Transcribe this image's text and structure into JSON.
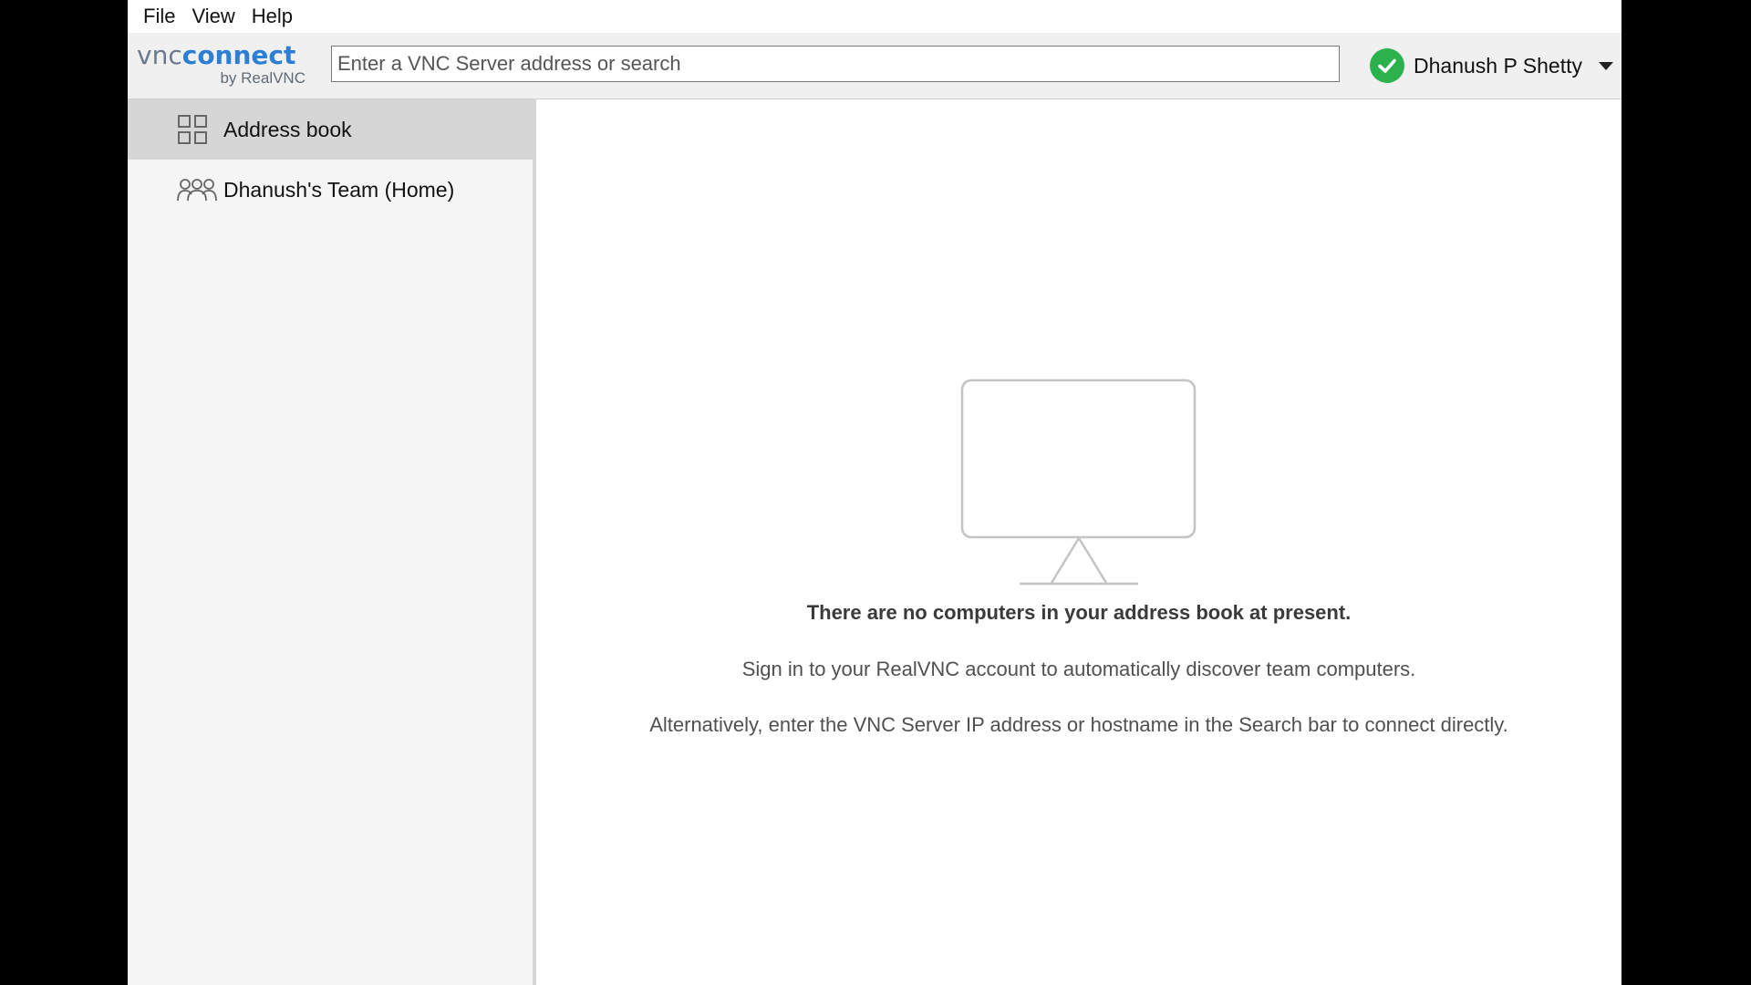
{
  "menubar": {
    "items": [
      {
        "label": "File"
      },
      {
        "label": "View"
      },
      {
        "label": "Help"
      }
    ]
  },
  "toolbar": {
    "logo": {
      "vnc": "vnc",
      "connect": "connect",
      "by": "by RealVNC"
    },
    "search": {
      "placeholder": "Enter a VNC Server address or search",
      "value": ""
    },
    "user": {
      "name": "Dhanush P Shetty",
      "status_icon": "check-circle-icon",
      "status_color": "#2bb24c"
    }
  },
  "sidebar": {
    "items": [
      {
        "label": "Address book",
        "icon": "grid-icon",
        "active": true
      },
      {
        "label": "Dhanush's Team (Home)",
        "icon": "team-icon",
        "active": false
      }
    ]
  },
  "main": {
    "empty_state": {
      "icon": "monitor-icon",
      "title": "There are no computers in your address book at present.",
      "line1": "Sign in to your RealVNC account to automatically discover team computers.",
      "line2": "Alternatively, enter the VNC Server IP address or hostname in the Search bar to connect directly."
    }
  },
  "colors": {
    "accent": "#2d7fd3",
    "sidebar_active": "#d6d6d6",
    "toolbar_bg": "#f0f0f0"
  }
}
